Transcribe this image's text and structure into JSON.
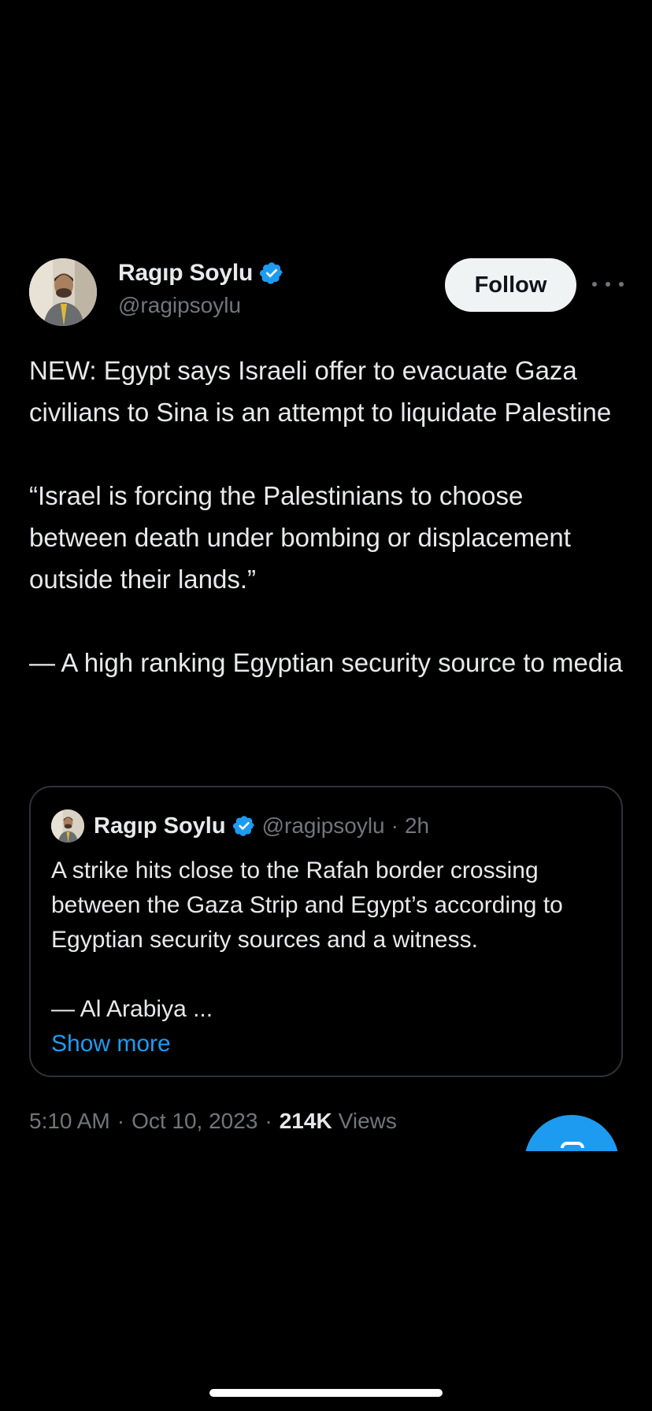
{
  "tweet": {
    "author": {
      "name": "Ragıp Soylu",
      "handle": "@ragipsoylu",
      "verified": true
    },
    "follow_label": "Follow",
    "more_icon": "more-horizontal-icon",
    "body": {
      "line1": "NEW: Egypt says Israeli offer to evacuate Gaza civilians to Sina is an attempt to liquidate Palestine",
      "line2": "“Israel is forcing the Palestinians to choose between death under bombing or displacement outside their lands.”",
      "line3": "— A high ranking Egyptian security source to media"
    },
    "quote": {
      "name": "Ragıp Soylu",
      "handle": "@ragipsoylu",
      "separator": "·",
      "time": "2h",
      "text1": "A strike hits close to the Rafah border crossing between the Gaza Strip and Egypt’s according to Egyptian security sources and a witness.",
      "text2": "— Al Arabiya ...",
      "show_more": "Show more"
    },
    "meta": {
      "time": "5:10 AM",
      "separator": "·",
      "date": "Oct 10, 2023",
      "views_count": "214K",
      "views_label": "Views"
    }
  },
  "colors": {
    "background": "#000000",
    "text": "#e7e9ea",
    "muted": "#71767b",
    "accent": "#1d9bf0",
    "border": "#2f3336"
  }
}
